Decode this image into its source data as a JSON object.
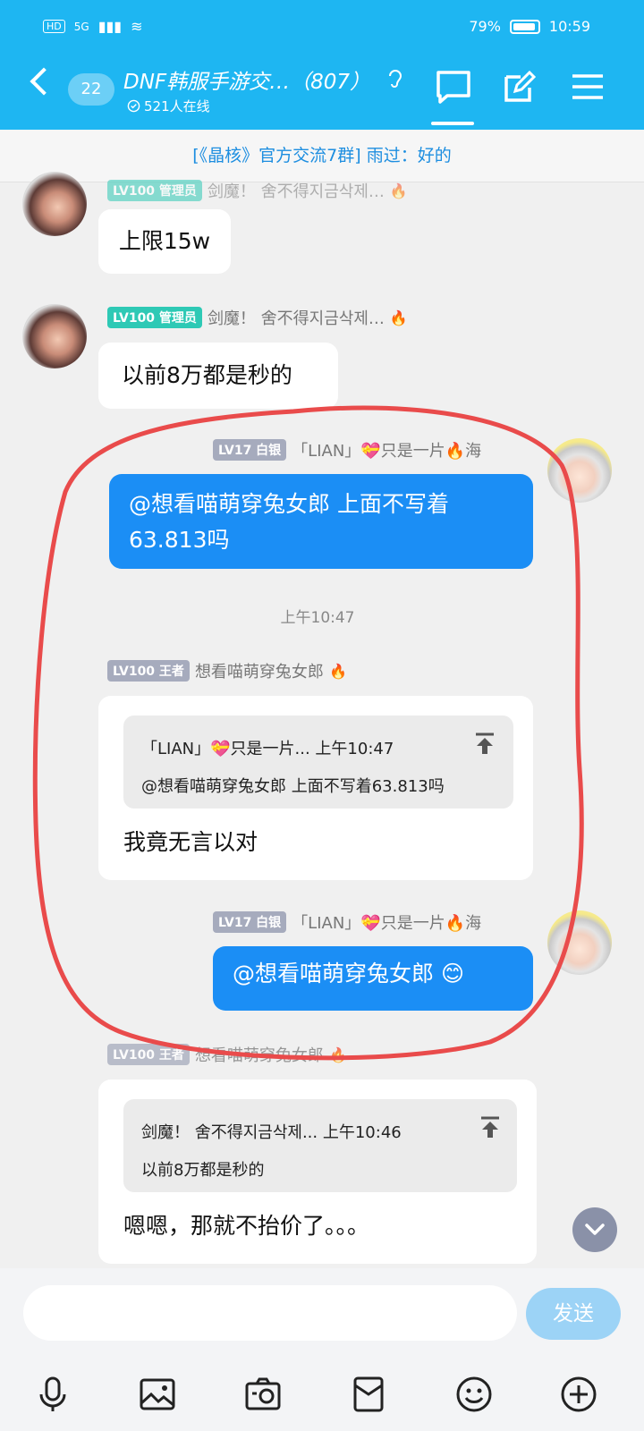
{
  "status_bar": {
    "network": "HD",
    "signal": "5G",
    "battery": "79%",
    "time": "10:59"
  },
  "header": {
    "unread_count": "22",
    "title": "DNF韩服手游交…（807）",
    "online": "521人在线"
  },
  "banner": {
    "text": "[《晶核》官方交流7群] 雨过：好的"
  },
  "messages": [
    {
      "level": "LV100 管理员",
      "nickname": "剑魔！ 舍不得지금삭제…",
      "text": "上限15w"
    },
    {
      "level": "LV100 管理员",
      "nickname": "剑魔！ 舍不得지금삭제…",
      "text": "以前8万都是秒的"
    },
    {
      "level": "LV17 白银",
      "nickname": "「LIAN」💝只是一片🔥海",
      "text": "@想看喵萌穿兔女郎 上面不写着63.813吗"
    },
    {
      "time": "上午10:47"
    },
    {
      "level": "LV100 王者",
      "nickname": "想看喵萌穿兔女郎",
      "quote_header": "「LIAN」💝只是一片... 上午10:47",
      "quote_text": "@想看喵萌穿兔女郎 上面不写着63.813吗",
      "text": "我竟无言以对"
    },
    {
      "level": "LV17 白银",
      "nickname": "「LIAN」💝只是一片🔥海",
      "text": "@想看喵萌穿兔女郎 😊"
    },
    {
      "level": "LV100 王者",
      "nickname": "想看喵萌穿兔女郎",
      "quote_header": "剑魔！ 舍不得지금삭제... 上午10:46",
      "quote_text": "以前8万都是秒的",
      "text": "嗯嗯，那就不抬价了。。。"
    }
  ],
  "input": {
    "placeholder": "",
    "send_label": "发送"
  },
  "icons": [
    "back-arrow-icon",
    "chat-icon",
    "edit-icon",
    "menu-icon",
    "ear-icon",
    "microphone-icon",
    "image-icon",
    "camera-icon",
    "red-packet-icon",
    "emoji-icon",
    "plus-icon",
    "pin-icon",
    "chevron-down-icon",
    "fire-icon"
  ],
  "colors": {
    "header": "#1eb6f2",
    "bubble_blue": "#1b8ef5",
    "annotation": "#e94b4b"
  }
}
